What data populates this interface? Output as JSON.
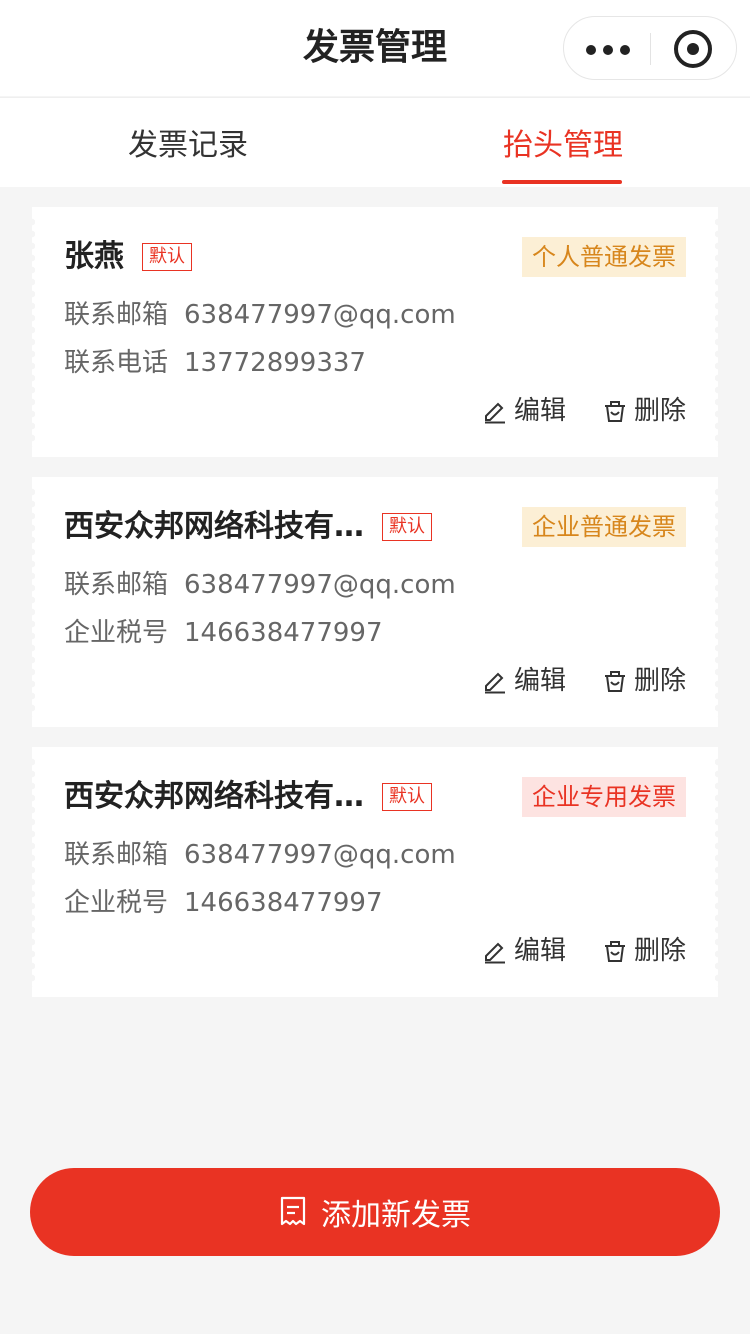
{
  "navbar": {
    "title": "发票管理",
    "more_icon": "more-dots-icon",
    "close_icon": "record-circle-icon"
  },
  "tabs": [
    {
      "label": "发票记录",
      "active": false
    },
    {
      "label": "抬头管理",
      "active": true
    }
  ],
  "colors": {
    "accent": "#e93323",
    "tag_yellow_bg": "#fcefd5",
    "tag_yellow_text": "#d7861c",
    "tag_red_bg": "#fde3e1",
    "background": "#f5f5f5"
  },
  "cards": [
    {
      "name": "张燕",
      "default_label": "默认",
      "type": "个人普通发票",
      "rows": [
        {
          "label": "联系邮箱",
          "value": "638477997@qq.com"
        },
        {
          "label": "联系电话",
          "value": "13772899337"
        }
      ],
      "edit_label": "编辑",
      "delete_label": "删除"
    },
    {
      "name": "西安众邦网络科技有...",
      "default_label": "默认",
      "type": "企业普通发票",
      "rows": [
        {
          "label": "联系邮箱",
          "value": "638477997@qq.com"
        },
        {
          "label": "企业税号",
          "value": "146638477997"
        }
      ],
      "edit_label": "编辑",
      "delete_label": "删除"
    },
    {
      "name": "西安众邦网络科技有...",
      "default_label": "默认",
      "type": "企业专用发票",
      "rows": [
        {
          "label": "联系邮箱",
          "value": "638477997@qq.com"
        },
        {
          "label": "企业税号",
          "value": "146638477997"
        }
      ],
      "edit_label": "编辑",
      "delete_label": "删除"
    }
  ],
  "add_button": {
    "label": "添加新发票",
    "icon": "invoice-icon"
  }
}
